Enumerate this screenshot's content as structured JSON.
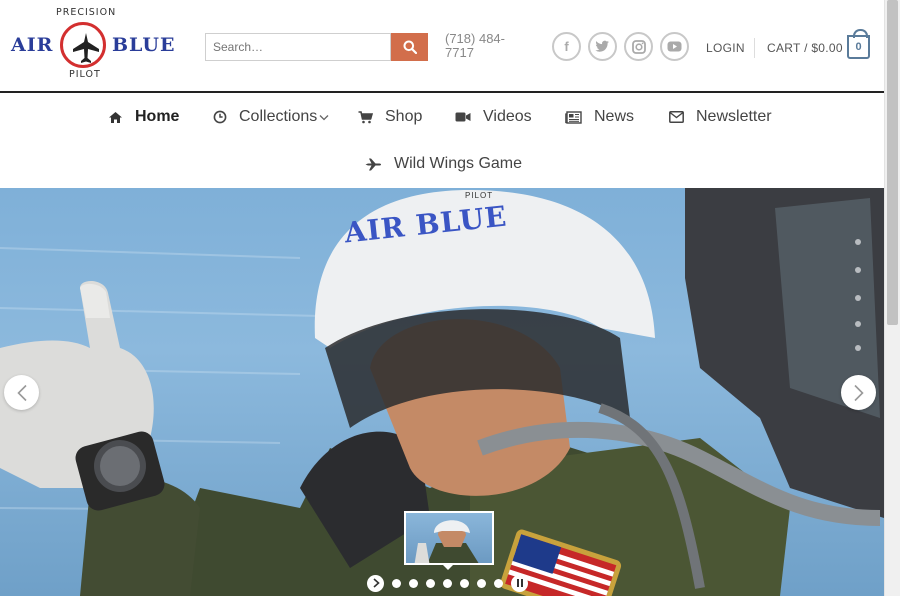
{
  "brand": {
    "word_left": "AIR",
    "word_right": "BLUE",
    "arc_top": "PRECISION",
    "arc_bottom": "PILOT",
    "accent": "#2a3d99",
    "ring_color": "#d32f2f"
  },
  "search": {
    "placeholder": "Search…"
  },
  "phone": "(718) 484-7717",
  "social_icons": [
    "facebook-icon",
    "twitter-icon",
    "instagram-icon",
    "youtube-icon"
  ],
  "account": {
    "login_label": "LOGIN",
    "cart_label": "CART / $0.00",
    "cart_count": "0"
  },
  "nav": {
    "items": [
      {
        "label": "Home",
        "icon": "home-icon",
        "active": true
      },
      {
        "label": "Collections",
        "icon": "clock-icon",
        "dropdown": true
      },
      {
        "label": "Shop",
        "icon": "cart-icon"
      },
      {
        "label": "Videos",
        "icon": "video-camera-icon"
      },
      {
        "label": "News",
        "icon": "newspaper-icon"
      },
      {
        "label": "Newsletter",
        "icon": "envelope-icon"
      },
      {
        "label": "Wild Wings Game",
        "icon": "plane-icon"
      }
    ]
  },
  "hero": {
    "helmet_text": "AIR BLUE",
    "helmet_arc": "PILOT",
    "slide_dots": 7,
    "accent_orange": "#d26e4b"
  }
}
